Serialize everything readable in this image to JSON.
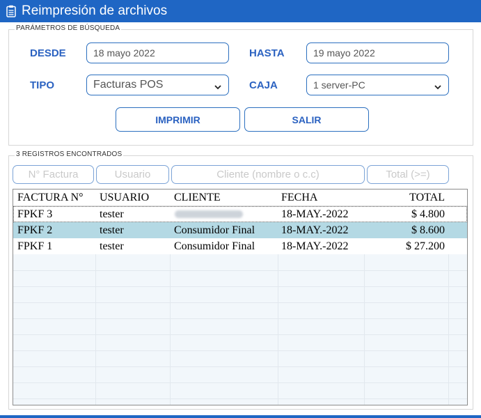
{
  "window": {
    "title": "Reimpresión de archivos"
  },
  "search": {
    "legend": "PARÁMETROS DE BÚSQUEDA",
    "desde_label": "DESDE",
    "desde_value": "18 mayo 2022",
    "hasta_label": "HASTA",
    "hasta_value": "19 mayo 2022",
    "tipo_label": "TIPO",
    "tipo_value": "Facturas POS",
    "caja_label": "CAJA",
    "caja_value": "1 server-PC",
    "print_label": "IMPRIMIR",
    "exit_label": "SALIR"
  },
  "results": {
    "legend": "3 REGISTROS ENCONTRADOS",
    "filters": {
      "factura_placeholder": "N° Factura",
      "usuario_placeholder": "Usuario",
      "cliente_placeholder": "Cliente (nombre o c.c)",
      "total_placeholder": "Total (>=)"
    },
    "columns": [
      "FACTURA N°",
      "USUARIO",
      "CLIENTE",
      "FECHA",
      "TOTAL"
    ],
    "rows": [
      {
        "factura": "FPKF 3",
        "usuario": "tester",
        "cliente": "",
        "fecha": "18-MAY.-2022",
        "total": "$ 4.800"
      },
      {
        "factura": "FPKF 2",
        "usuario": "tester",
        "cliente": "Consumidor Final",
        "fecha": "18-MAY.-2022",
        "total": "$ 8.600"
      },
      {
        "factura": "FPKF 1",
        "usuario": "tester",
        "cliente": "Consumidor Final",
        "fecha": "18-MAY.-2022",
        "total": "$ 27.200"
      }
    ]
  },
  "colors": {
    "accent": "#1f66c4",
    "selected_row": "#b4d9e4"
  }
}
